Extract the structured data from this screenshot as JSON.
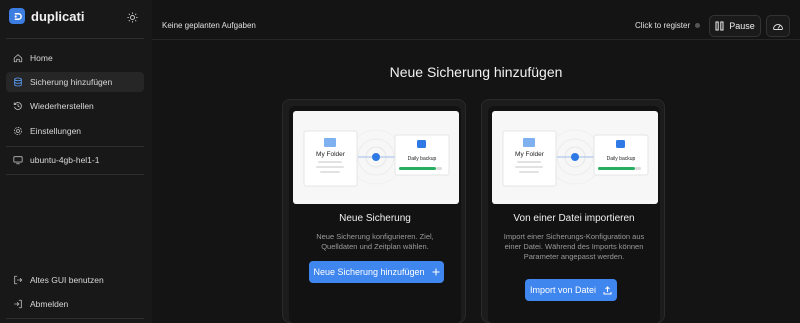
{
  "sidebar": {
    "brand": "duplicati",
    "items": [
      {
        "label": "Home",
        "icon": "home-icon"
      },
      {
        "label": "Sicherung hinzufügen",
        "icon": "database-icon",
        "active": true
      },
      {
        "label": "Wiederherstellen",
        "icon": "history-icon"
      },
      {
        "label": "Einstellungen",
        "icon": "gear-icon"
      }
    ],
    "machine": {
      "label": "ubuntu-4gb-hel1-1",
      "icon": "monitor-icon"
    },
    "bottom": [
      {
        "label": "Altes GUI benutzen",
        "icon": "exit-icon"
      },
      {
        "label": "Abmelden",
        "icon": "logout-icon"
      }
    ]
  },
  "topbar": {
    "status": "Keine geplanten Aufgaben",
    "register": "Click to register",
    "pause": "Pause"
  },
  "page": {
    "title": "Neue Sicherung hinzufügen"
  },
  "cards": [
    {
      "illus_folder": "My Folder",
      "illus_backup": "Daily backup",
      "title": "Neue Sicherung",
      "description": "Neue Sicherung konfigurieren. Ziel, Quelldaten und Zeitplan wählen.",
      "button": "Neue Sicherung hinzufügen"
    },
    {
      "illus_folder": "My Folder",
      "illus_backup": "Daily backup",
      "title": "Von einer Datei importieren",
      "description": "Import einer Sicherungs-Konfiguration aus einer Datei. Während des Imports können Parameter angepasst werden.",
      "button": "Import von Datei"
    }
  ],
  "colors": {
    "accent": "#3f86ee",
    "progress": "#27ae60",
    "background": "#141414",
    "sidebar": "#181818"
  }
}
